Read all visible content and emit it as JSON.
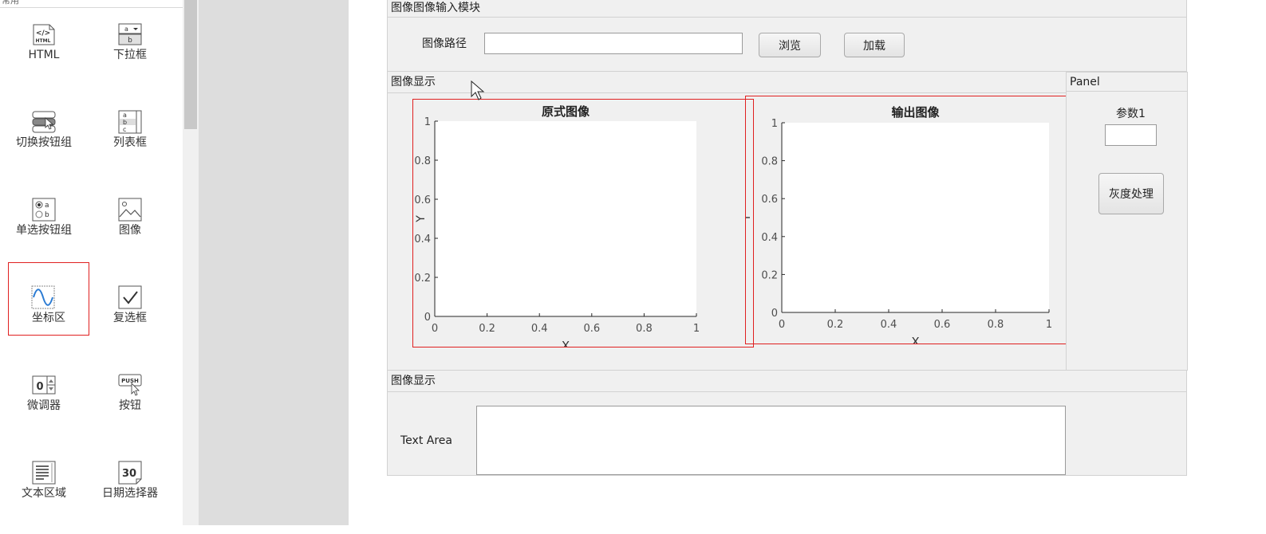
{
  "library": {
    "header": "常用",
    "components": [
      {
        "label": "HTML",
        "icon": "html-icon"
      },
      {
        "label": "下拉框",
        "icon": "dropdown-icon"
      },
      {
        "label": "切换按钮组",
        "icon": "toggle-button-group-icon"
      },
      {
        "label": "列表框",
        "icon": "listbox-icon"
      },
      {
        "label": "单选按钮组",
        "icon": "radio-button-group-icon"
      },
      {
        "label": "图像",
        "icon": "image-icon"
      },
      {
        "label": "坐标区",
        "icon": "axes-icon",
        "selected": true
      },
      {
        "label": "复选框",
        "icon": "checkbox-icon"
      },
      {
        "label": "微调器",
        "icon": "spinner-icon"
      },
      {
        "label": "按钮",
        "icon": "push-button-icon"
      },
      {
        "label": "文本区域",
        "icon": "text-area-icon"
      },
      {
        "label": "日期选择器",
        "icon": "date-picker-icon"
      }
    ],
    "icon_text": {
      "html_top": "</>",
      "html_bottom": "HTML",
      "dropdown_top": "a",
      "dropdown_bottom": "b",
      "listbox_a": "a",
      "listbox_b": "b",
      "listbox_c": "c",
      "radio_a": "a",
      "radio_b": "b",
      "spinner_value": "0",
      "push_text": "PUSH",
      "date_value": "30"
    }
  },
  "input_panel": {
    "title": "图像图像输入模块",
    "path_label": "图像路径",
    "path_value": "",
    "browse_label": "浏览",
    "load_label": "加载"
  },
  "display_panel": {
    "title": "图像显示"
  },
  "side_panel": {
    "title": "Panel",
    "param_label": "参数1",
    "param_value": "",
    "gray_button_label": "灰度处理"
  },
  "text_panel": {
    "title": "图像显示",
    "textarea_label": "Text Area",
    "textarea_value": ""
  },
  "colors": {
    "selection_red": "#e02020",
    "axes_line": "#262626",
    "tick_text": "#4d4d4d",
    "panel_bg": "#f0f0f0"
  },
  "chart_data": [
    {
      "type": "line",
      "title": "原式图像",
      "xlabel": "X",
      "ylabel": "Y",
      "xlim": [
        0,
        1
      ],
      "ylim": [
        0,
        1
      ],
      "xticks": [
        "0",
        "0.2",
        "0.4",
        "0.6",
        "0.8",
        "1"
      ],
      "yticks": [
        "0",
        "0.2",
        "0.4",
        "0.6",
        "0.8",
        "1"
      ],
      "series": [],
      "grid": false
    },
    {
      "type": "line",
      "title": "输出图像",
      "xlabel": "X",
      "ylabel": "Y",
      "xlim": [
        0,
        1
      ],
      "ylim": [
        0,
        1
      ],
      "xticks": [
        "0",
        "0.2",
        "0.4",
        "0.6",
        "0.8",
        "1"
      ],
      "yticks": [
        "0",
        "0.2",
        "0.4",
        "0.6",
        "0.8",
        "1"
      ],
      "series": [],
      "grid": false
    }
  ]
}
